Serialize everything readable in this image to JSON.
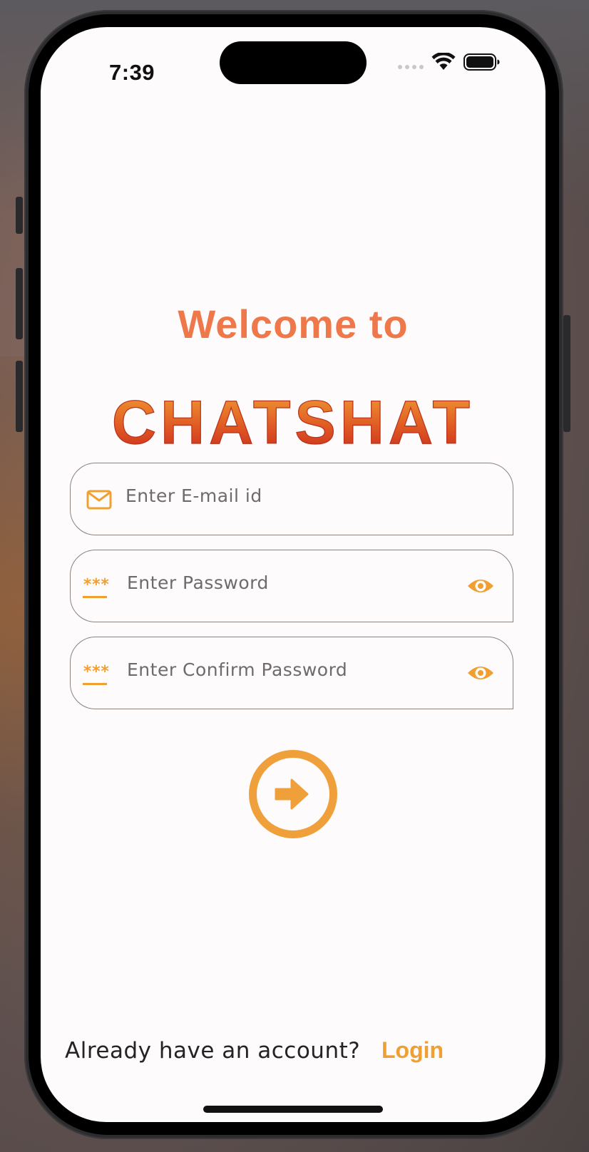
{
  "status_bar": {
    "time": "7:39"
  },
  "header": {
    "welcome": "Welcome to",
    "brand": "CHATSHAT"
  },
  "form": {
    "email": {
      "placeholder": "Enter E-mail id",
      "icon": "mail-icon"
    },
    "password": {
      "placeholder": "Enter Password",
      "icon": "password-icon",
      "toggle_icon": "eye-icon",
      "mask": "***"
    },
    "confirm_password": {
      "placeholder": "Enter Confirm Password",
      "icon": "password-icon",
      "toggle_icon": "eye-icon",
      "mask": "***"
    },
    "submit_icon": "arrow-right-circle-icon"
  },
  "footer": {
    "prompt": "Already have an account?",
    "login_label": "Login"
  },
  "colors": {
    "accent": "#f0a031",
    "welcome": "#ee784a",
    "brand_top": "#f0a034",
    "brand_bottom": "#c8281c",
    "background": "#fdfbfc"
  }
}
